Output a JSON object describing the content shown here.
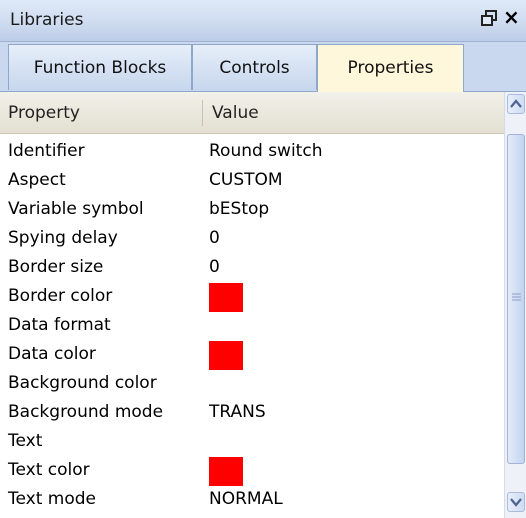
{
  "window": {
    "title": "Libraries"
  },
  "tabs": [
    {
      "label": "Function Blocks"
    },
    {
      "label": "Controls"
    },
    {
      "label": "Properties"
    }
  ],
  "active_tab": "Properties",
  "table": {
    "columns": [
      "Property",
      "Value"
    ],
    "rows": [
      {
        "key": "Identifier",
        "value": "Round switch"
      },
      {
        "key": "Aspect",
        "value": "CUSTOM"
      },
      {
        "key": "Variable symbol",
        "value": "bEStop"
      },
      {
        "key": "Spying delay",
        "value": "0"
      },
      {
        "key": "Border size",
        "value": "0"
      },
      {
        "key": "Border color",
        "value": "",
        "swatch": "#ff0000"
      },
      {
        "key": "Data format",
        "value": ""
      },
      {
        "key": "Data color",
        "value": "",
        "swatch": "#ff0000"
      },
      {
        "key": "Background color",
        "value": ""
      },
      {
        "key": "Background mode",
        "value": "TRANS"
      },
      {
        "key": "Text",
        "value": ""
      },
      {
        "key": "Text color",
        "value": "",
        "swatch": "#ff0000"
      },
      {
        "key": "Text mode",
        "value": "NORMAL"
      }
    ]
  },
  "icons": {
    "float": "window-float-icon",
    "close": "close-icon",
    "up": "scroll-up-arrow-icon",
    "down": "scroll-down-arrow-icon"
  }
}
